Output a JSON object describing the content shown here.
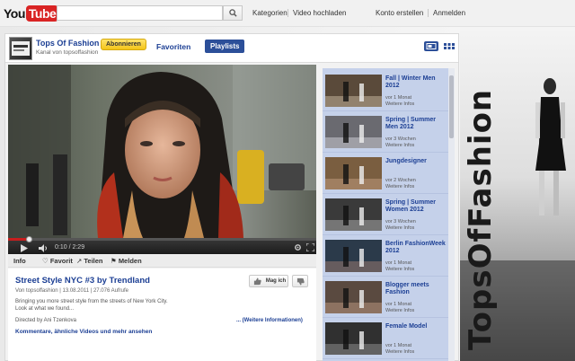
{
  "masthead": {
    "logo_you": "You",
    "logo_tube": "Tube",
    "search_placeholder": "",
    "links": {
      "categories": "Kategorien",
      "upload": "Video hochladen",
      "create_account": "Konto erstellen",
      "login": "Anmelden"
    }
  },
  "background": {
    "brand_text": "TopsOfFashion"
  },
  "channel": {
    "name": "Tops Of Fashion",
    "subtitle": "Kanal von topsoffashion",
    "subscribe_label": "Abonnieren",
    "tabs": {
      "favorites": "Favoriten",
      "playlists": "Playlists"
    }
  },
  "player": {
    "time": "0:10 / 2:29",
    "progress_fraction": 0.067
  },
  "actions": {
    "info": "Info",
    "favorite": "Favorit",
    "share": "Teilen",
    "report": "Melden"
  },
  "video": {
    "title": "Street Style NYC #3 by Trendland",
    "meta": "Von topsoffashion | 13.08.2011 | 27.076 Aufrufe",
    "description_line1": "Bringing you more street style from the streets of New York City.",
    "description_line2": "Look at what we found...",
    "director": "Directed by Ani Tzenkova",
    "more_info": "... (Weitere Informationen)",
    "comments_link": "Kommentare, ähnliche Videos und mehr ansehen",
    "like_label": "Mag ich"
  },
  "playlist": {
    "items": [
      {
        "title": "Fall | Winter Men 2012",
        "age": "vor 1 Monat",
        "more": "Weitere Infos"
      },
      {
        "title": "Spring | Summer Men 2012",
        "age": "vor 3 Wochen",
        "more": "Weitere Infos"
      },
      {
        "title": "Jungdesigner",
        "age": "vor 2 Wochen",
        "more": "Weitere Infos"
      },
      {
        "title": "Spring | Summer Women 2012",
        "age": "vor 3 Wochen",
        "more": "Weitere Infos"
      },
      {
        "title": "Berlin FashionWeek 2012",
        "age": "vor 1 Monat",
        "more": "Weitere Infos"
      },
      {
        "title": "Blogger meets Fashion",
        "age": "vor 1 Monat",
        "more": "Weitere Infos"
      },
      {
        "title": "Female Model",
        "age": "vor 1 Monat",
        "more": "Weitere Infos"
      }
    ]
  },
  "colors": {
    "link_blue": "#1c3f94",
    "youtube_red": "#d92424",
    "subscribe_yellow": "#f4c518",
    "playlist_bg": "#c5d1ea"
  }
}
